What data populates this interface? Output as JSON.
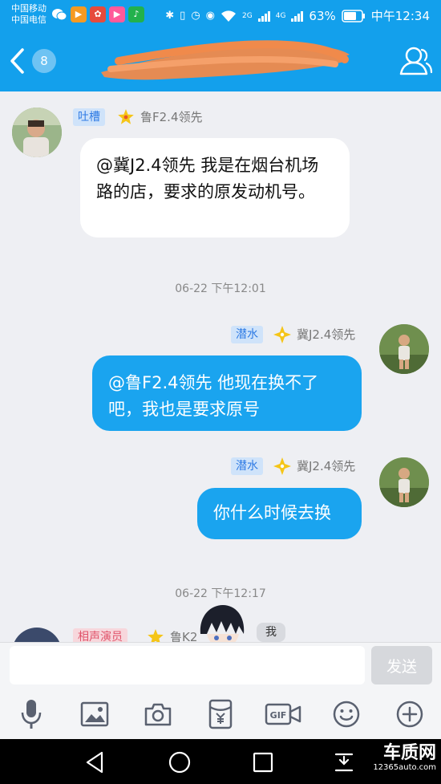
{
  "status_bar": {
    "carrier_1": "中国移动",
    "carrier_2": "中国电信",
    "network_2g": "2G",
    "network_4g": "4G",
    "battery": "63%",
    "time": "中午12:34",
    "app_icons": [
      "wechat-icon",
      "app-icon-orange",
      "app-icon-multicolor",
      "video-app-icon",
      "music-app-icon"
    ]
  },
  "nav": {
    "unread_count": "8",
    "title": "",
    "back_icon": "chevron-left-icon",
    "profile_icon": "profile-icon"
  },
  "messages": [
    {
      "direction": "incoming",
      "tag": "吐槽",
      "sender": "鲁F2.4领先",
      "text": "@冀J2.4领先 我是在烟台机场路的店，要求的原发动机号。"
    },
    {
      "direction": "outgoing",
      "tag": "潜水",
      "sender": "冀J2.4领先",
      "text": "@鲁F2.4领先 他现在换不了吧，我也是要求原号"
    },
    {
      "direction": "outgoing",
      "tag": "潜水",
      "sender": "冀J2.4领先",
      "text": "你什么时候去换"
    },
    {
      "direction": "incoming",
      "tag": "相声演员",
      "sender": "鲁K2",
      "bubble_preview": "我"
    }
  ],
  "timestamps": [
    "06-22 下午12:01",
    "06-22 下午12:17"
  ],
  "input": {
    "value": "",
    "placeholder": "",
    "send_label": "发送",
    "gif_label": "GIF"
  },
  "toolbar_icons": [
    "microphone-icon",
    "image-icon",
    "camera-icon",
    "red-packet-icon",
    "gif-icon",
    "emoji-icon",
    "plus-icon"
  ],
  "system_nav": [
    "back-triangle-icon",
    "home-circle-icon",
    "recents-square-icon",
    "notification-pull-icon"
  ],
  "watermark": {
    "name": "车质网",
    "url": "12365auto.com"
  },
  "colors": {
    "brand_blue": "#13a0ec",
    "bubble_blue": "#1aa4ef",
    "scribble_orange": "#f08a4b",
    "badge_blue": "#6ec3f3",
    "background": "#eeeff3"
  }
}
